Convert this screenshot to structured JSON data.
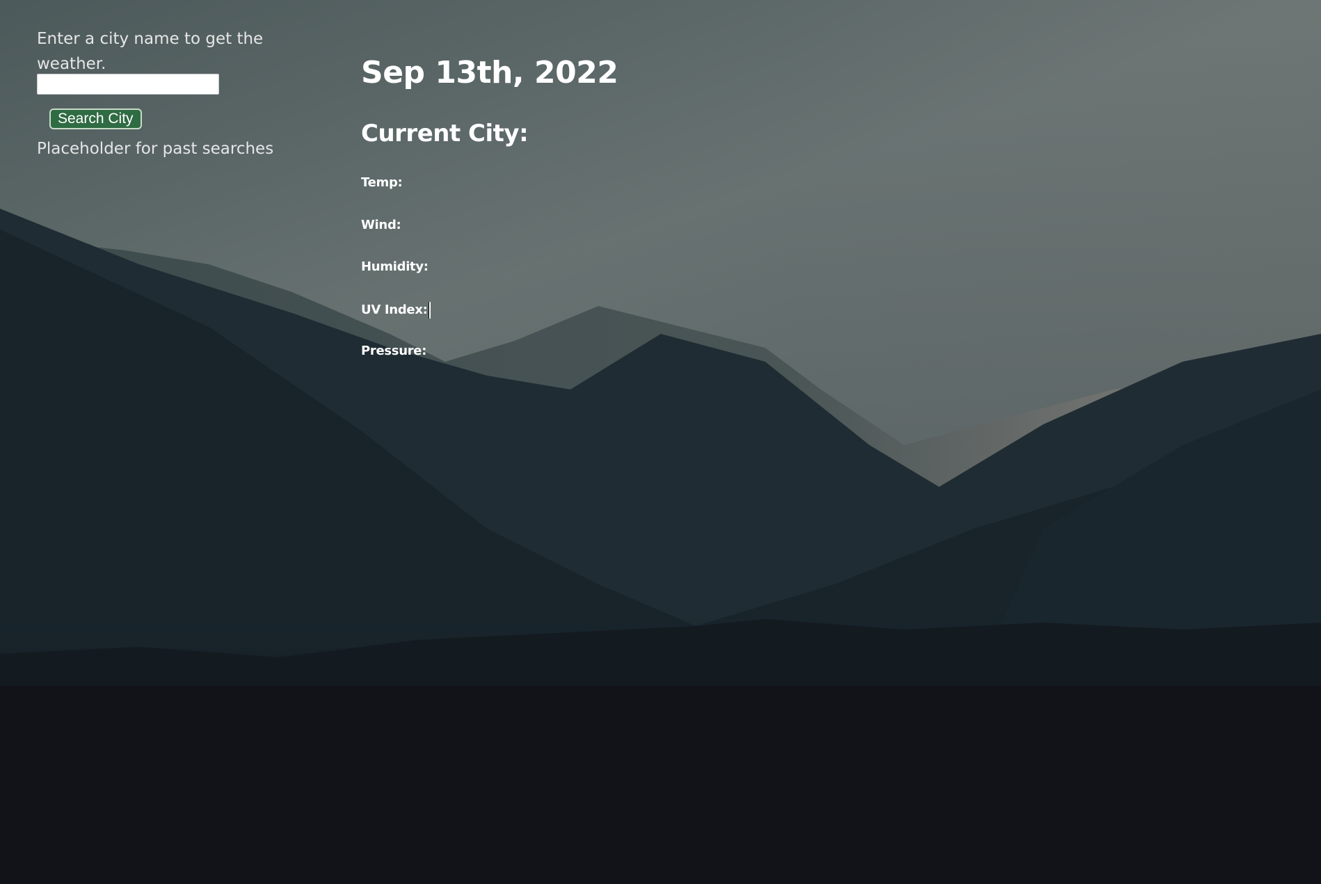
{
  "colors": {
    "page_background": "#111319",
    "text": "#ffffff",
    "button_background": "#2f6b43"
  },
  "sidebar": {
    "prompt": "Enter a city name to get the weather.",
    "search_input": {
      "value": "",
      "placeholder": ""
    },
    "search_button_label": "Search City",
    "past_searches_placeholder": "Placeholder for past searches"
  },
  "main": {
    "date": "Sep 13th, 2022",
    "current_city_label": "Current City:",
    "stats": {
      "temp_label": "Temp:",
      "wind_label": "Wind:",
      "humidity_label": "Humidity:",
      "uv_index_label": "UV Index:",
      "pressure_label": "Pressure:"
    }
  }
}
